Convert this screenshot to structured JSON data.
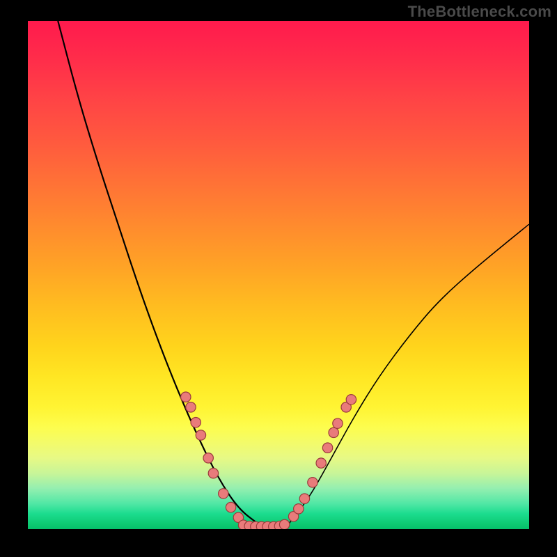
{
  "watermark": "TheBottleneck.com",
  "colors": {
    "frame_bg": "#000000",
    "dot_fill": "#e97b7b",
    "dot_stroke": "#9a3b3b",
    "curve": "#000000"
  },
  "chart_data": {
    "type": "line",
    "title": "",
    "xlabel": "",
    "ylabel": "",
    "xlim": [
      0,
      100
    ],
    "ylim": [
      0,
      100
    ],
    "grid": false,
    "legend": false,
    "left_curve": [
      {
        "x": 6,
        "y": 100
      },
      {
        "x": 10,
        "y": 85
      },
      {
        "x": 14,
        "y": 72
      },
      {
        "x": 18,
        "y": 60
      },
      {
        "x": 22,
        "y": 48
      },
      {
        "x": 26,
        "y": 37
      },
      {
        "x": 30,
        "y": 27
      },
      {
        "x": 34,
        "y": 18
      },
      {
        "x": 38,
        "y": 10
      },
      {
        "x": 42,
        "y": 4
      },
      {
        "x": 46,
        "y": 1
      }
    ],
    "right_curve": [
      {
        "x": 52,
        "y": 1
      },
      {
        "x": 56,
        "y": 6
      },
      {
        "x": 60,
        "y": 13
      },
      {
        "x": 65,
        "y": 22
      },
      {
        "x": 70,
        "y": 30
      },
      {
        "x": 76,
        "y": 38
      },
      {
        "x": 82,
        "y": 45
      },
      {
        "x": 90,
        "y": 52
      },
      {
        "x": 100,
        "y": 60
      }
    ],
    "flat_segment": [
      {
        "x": 42,
        "y": 0.5
      },
      {
        "x": 52,
        "y": 0.5
      }
    ],
    "dots_left": [
      {
        "x": 31.5,
        "y": 26
      },
      {
        "x": 32.5,
        "y": 24
      },
      {
        "x": 33.5,
        "y": 21
      },
      {
        "x": 34.5,
        "y": 18.5
      },
      {
        "x": 36.0,
        "y": 14
      },
      {
        "x": 37.0,
        "y": 11
      },
      {
        "x": 39.0,
        "y": 7
      },
      {
        "x": 40.5,
        "y": 4.3
      },
      {
        "x": 42.0,
        "y": 2.3
      }
    ],
    "dots_flat": [
      {
        "x": 43.0,
        "y": 0.8
      },
      {
        "x": 44.2,
        "y": 0.6
      },
      {
        "x": 45.4,
        "y": 0.5
      },
      {
        "x": 46.6,
        "y": 0.5
      },
      {
        "x": 47.8,
        "y": 0.5
      },
      {
        "x": 49.0,
        "y": 0.5
      },
      {
        "x": 50.2,
        "y": 0.6
      },
      {
        "x": 51.2,
        "y": 0.9
      }
    ],
    "dots_right": [
      {
        "x": 53.0,
        "y": 2.5
      },
      {
        "x": 54.0,
        "y": 4.0
      },
      {
        "x": 55.2,
        "y": 6.0
      },
      {
        "x": 56.8,
        "y": 9.2
      },
      {
        "x": 58.5,
        "y": 13.0
      },
      {
        "x": 59.8,
        "y": 16.0
      },
      {
        "x": 61.0,
        "y": 19.0
      },
      {
        "x": 61.8,
        "y": 20.8
      },
      {
        "x": 63.5,
        "y": 24.0
      },
      {
        "x": 64.5,
        "y": 25.5
      }
    ]
  }
}
